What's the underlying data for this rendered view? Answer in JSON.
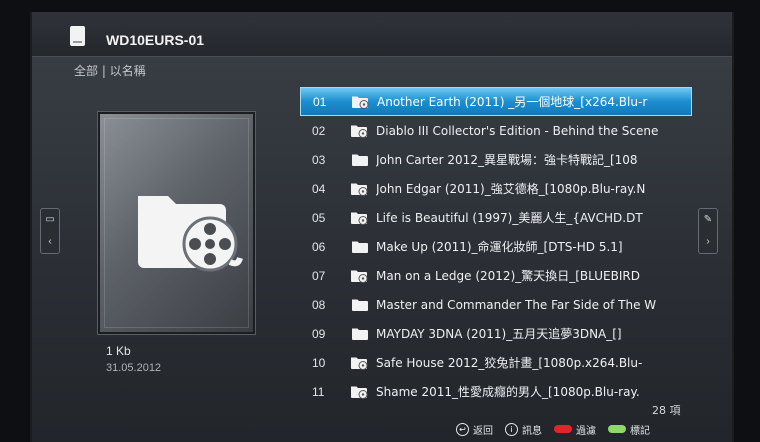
{
  "header": {
    "device_name": "WD10EURS-01"
  },
  "breadcrumb": "全部 | 以名稱",
  "preview": {
    "size": "1 Kb",
    "date": "31.05.2012"
  },
  "items": [
    {
      "num": "01",
      "name": "Another Earth (2011) _另一個地球_[x264.Blu-r",
      "icon": "video-folder-icon",
      "selected": true
    },
    {
      "num": "02",
      "name": "Diablo III Collector's Edition - Behind the Scene",
      "icon": "video-folder-icon",
      "selected": false
    },
    {
      "num": "03",
      "name": "John Carter 2012_異星戰場：強卡特戰記_[108",
      "icon": "folder-icon",
      "selected": false
    },
    {
      "num": "04",
      "name": "John Edgar (2011)_強艾德格_[1080p.Blu-ray.N",
      "icon": "video-folder-icon",
      "selected": false
    },
    {
      "num": "05",
      "name": "Life is Beautiful (1997)_美麗人生_{AVCHD.DT",
      "icon": "video-folder-icon",
      "selected": false
    },
    {
      "num": "06",
      "name": "Make Up (2011)_命運化妝師_[DTS-HD 5.1]",
      "icon": "folder-icon",
      "selected": false
    },
    {
      "num": "07",
      "name": "Man on a Ledge (2012)_驚天換日_[BLUEBIRD",
      "icon": "video-folder-icon",
      "selected": false
    },
    {
      "num": "08",
      "name": "Master and Commander The Far Side of The W",
      "icon": "folder-icon",
      "selected": false
    },
    {
      "num": "09",
      "name": "MAYDAY 3DNA (2011)_五月天追夢3DNA_[]",
      "icon": "folder-icon",
      "selected": false
    },
    {
      "num": "10",
      "name": "Safe House 2012_狡兔計畫_[1080p.x264.Blu-",
      "icon": "video-folder-icon",
      "selected": false
    },
    {
      "num": "11",
      "name": "Shame 2011_性愛成癮的男人_[1080p.Blu-ray.",
      "icon": "video-folder-icon",
      "selected": false
    }
  ],
  "count": "28 項",
  "footer": {
    "back": "返回",
    "info": "訊息",
    "filter": "過濾",
    "mark": "標記"
  }
}
